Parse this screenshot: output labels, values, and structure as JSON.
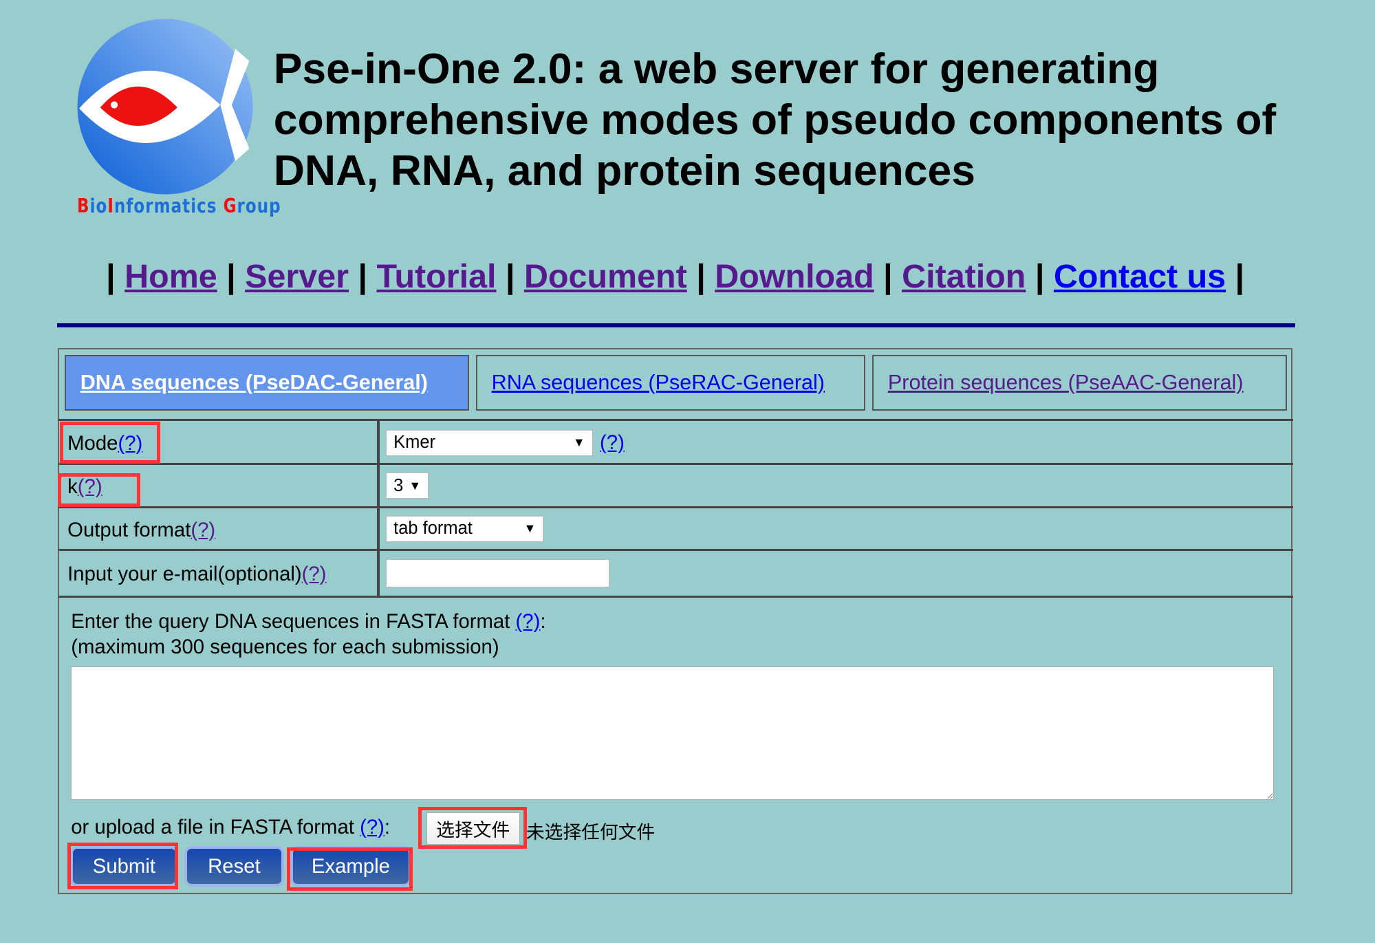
{
  "logo": {
    "text": "BioInformatics Group",
    "colors": {
      "circle": "#2a7de8",
      "fish": "#ee1111",
      "text": "#1d6fd8"
    }
  },
  "header": {
    "title": "Pse-in-One 2.0: a web server for generating comprehensive modes of pseudo components of DNA, RNA, and protein sequences"
  },
  "nav": {
    "items": [
      {
        "label": "Home"
      },
      {
        "label": "Server"
      },
      {
        "label": "Tutorial"
      },
      {
        "label": "Document"
      },
      {
        "label": "Download"
      },
      {
        "label": "Citation"
      },
      {
        "label": "Contact us"
      }
    ],
    "separator": "|"
  },
  "tabs": [
    {
      "label": "DNA sequences (PseDAC-General)",
      "active": true
    },
    {
      "label": "RNA sequences (PseRAC-General)"
    },
    {
      "label": "Protein sequences (PseAAC-General)"
    }
  ],
  "form": {
    "help": "(?)",
    "mode": {
      "label": "Mode",
      "value": "Kmer"
    },
    "k": {
      "label": "k",
      "value": "3"
    },
    "output": {
      "label": "Output format",
      "value": "tab format"
    },
    "email": {
      "label": "Input your e-mail(optional)",
      "value": ""
    },
    "query_label": "Enter the query DNA sequences in FASTA format ",
    "query_colon": ":",
    "query_note": "(maximum 300 sequences for each submission)",
    "sequences": "",
    "upload_label": "or upload a file in FASTA format ",
    "upload_colon": ":",
    "choose_file": "选择文件",
    "no_file": "未选择任何文件",
    "submit": "Submit",
    "reset": "Reset",
    "example": "Example"
  },
  "colors": {
    "background": "#99cccc",
    "active_tab": "#6495ed",
    "rule": "#000080",
    "highlight": "#ff3333"
  }
}
